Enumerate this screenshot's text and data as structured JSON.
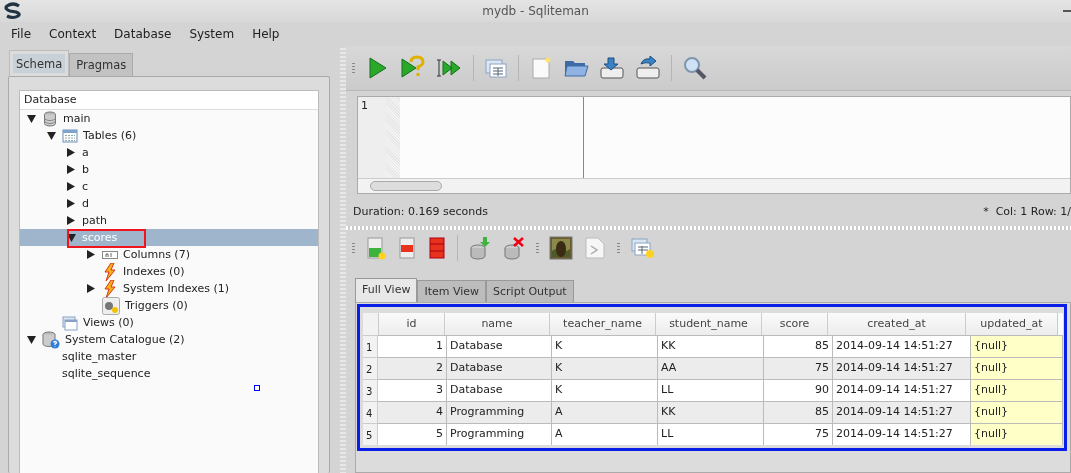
{
  "window": {
    "title": "mydb - Sqliteman"
  },
  "menu": [
    {
      "label": "File"
    },
    {
      "label": "Context"
    },
    {
      "label": "Database"
    },
    {
      "label": "System"
    },
    {
      "label": "Help"
    }
  ],
  "left_tabs": [
    {
      "label": "Schema",
      "selected": true
    },
    {
      "label": "Pragmas",
      "selected": false
    }
  ],
  "tree": {
    "header": "Database",
    "items": [
      {
        "label": "main",
        "kind": "database",
        "expanded": true,
        "selected": false,
        "children": [
          {
            "label": "Tables (6)",
            "kind": "tables",
            "expanded": true,
            "selected": false,
            "children": [
              {
                "label": "a",
                "expanded": false,
                "selected": false
              },
              {
                "label": "b",
                "expanded": false,
                "selected": false
              },
              {
                "label": "c",
                "expanded": false,
                "selected": false
              },
              {
                "label": "d",
                "expanded": false,
                "selected": false
              },
              {
                "label": "path",
                "expanded": false,
                "selected": false
              },
              {
                "label": "scores",
                "expanded": true,
                "selected": true,
                "children": [
                  {
                    "label": "Columns (7)",
                    "kind": "columns",
                    "expanded": false,
                    "selected": false
                  },
                  {
                    "label": "Indexes (0)",
                    "kind": "indexes",
                    "selected": false
                  },
                  {
                    "label": "System Indexes (1)",
                    "kind": "indexes",
                    "expanded": false,
                    "selected": false
                  },
                  {
                    "label": "Triggers (0)",
                    "kind": "triggers",
                    "selected": false
                  }
                ]
              }
            ]
          },
          {
            "label": "Views (0)",
            "kind": "views",
            "selected": false
          }
        ]
      },
      {
        "label": "System Catalogue (2)",
        "kind": "catalogue",
        "expanded": true,
        "selected": false,
        "children": [
          {
            "label": "sqlite_master",
            "selected": false
          },
          {
            "label": "sqlite_sequence",
            "selected": false
          }
        ]
      }
    ]
  },
  "editor": {
    "line_numbers": [
      "1"
    ]
  },
  "status": {
    "duration": "Duration: 0.169 seconds",
    "modified_marker": "*",
    "position": "Col: 1 Row: 1/"
  },
  "result_tabs": [
    {
      "label": "Full View",
      "selected": true
    },
    {
      "label": "Item View",
      "selected": false
    },
    {
      "label": "Script Output",
      "selected": false
    }
  ],
  "table": {
    "columns": [
      {
        "label": "id",
        "kind": "number",
        "highlight": false
      },
      {
        "label": "name",
        "kind": "text",
        "highlight": false
      },
      {
        "label": "teacher_name",
        "kind": "text",
        "highlight": false
      },
      {
        "label": "student_name",
        "kind": "text",
        "highlight": false
      },
      {
        "label": "score",
        "kind": "number",
        "highlight": false
      },
      {
        "label": "created_at",
        "kind": "text",
        "highlight": false
      },
      {
        "label": "updated_at",
        "kind": "text",
        "highlight": true
      }
    ],
    "rows": [
      {
        "number": "1",
        "cells": [
          "1",
          "Database",
          "K",
          "KK",
          "85",
          "2014-09-14 14:51:27",
          "{null}"
        ]
      },
      {
        "number": "2",
        "cells": [
          "2",
          "Database",
          "K",
          "AA",
          "75",
          "2014-09-14 14:51:27",
          "{null}"
        ]
      },
      {
        "number": "3",
        "cells": [
          "3",
          "Database",
          "K",
          "LL",
          "90",
          "2014-09-14 14:51:27",
          "{null}"
        ]
      },
      {
        "number": "4",
        "cells": [
          "4",
          "Programming",
          "A",
          "KK",
          "85",
          "2014-09-14 14:51:27",
          "{null}"
        ]
      },
      {
        "number": "5",
        "cells": [
          "5",
          "Programming",
          "A",
          "LL",
          "75",
          "2014-09-14 14:51:27",
          "{null}"
        ]
      }
    ]
  }
}
